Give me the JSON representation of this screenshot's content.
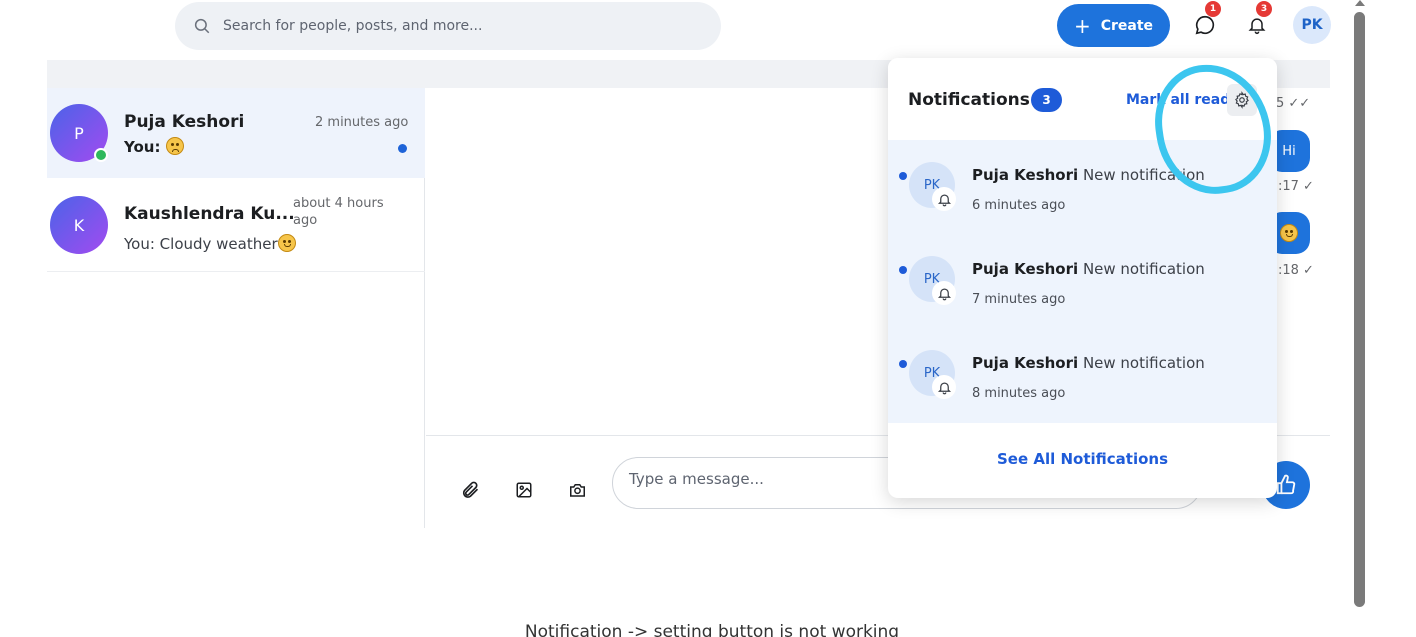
{
  "search": {
    "placeholder": "Search for people, posts, and more...",
    "icon": "search-icon"
  },
  "header": {
    "create_label": "Create",
    "messages_badge": "1",
    "notifications_badge": "3",
    "user_initials": "PK",
    "accent_color": "#1e73dc"
  },
  "chats": [
    {
      "initial": "P",
      "name": "Puja Keshori",
      "time": "2 minutes ago",
      "preview": "You:",
      "preview_emoji": "sad-emoji",
      "online": true,
      "unread": true,
      "active": true
    },
    {
      "initial": "K",
      "name": "Kaushlendra Ku...",
      "time": "about 4 hours ago",
      "preview": "You: Cloudy weather",
      "preview_emoji": "smile-emoji",
      "online": false,
      "unread": false,
      "active": false
    }
  ],
  "conversation": {
    "messages": [
      {
        "text": "Hi",
        "meta": ":17 ✓"
      },
      {
        "text": "",
        "meta": ":18 ✓"
      }
    ],
    "top_meta": "5 ✓✓"
  },
  "composer": {
    "placeholder": "Type a message..."
  },
  "notifications": {
    "title": "Notifications",
    "count": "3",
    "mark_all_read": "Mark all read",
    "see_all": "See All Notifications",
    "items": [
      {
        "initials": "PK",
        "sender": "Puja Keshori",
        "message": "New notification",
        "time": "6 minutes ago"
      },
      {
        "initials": "PK",
        "sender": "Puja Keshori",
        "message": "New notification",
        "time": "7 minutes ago"
      },
      {
        "initials": "PK",
        "sender": "Puja Keshori",
        "message": "New notification",
        "time": "8 minutes ago"
      }
    ]
  },
  "caption": "Notification -> setting button is not working"
}
